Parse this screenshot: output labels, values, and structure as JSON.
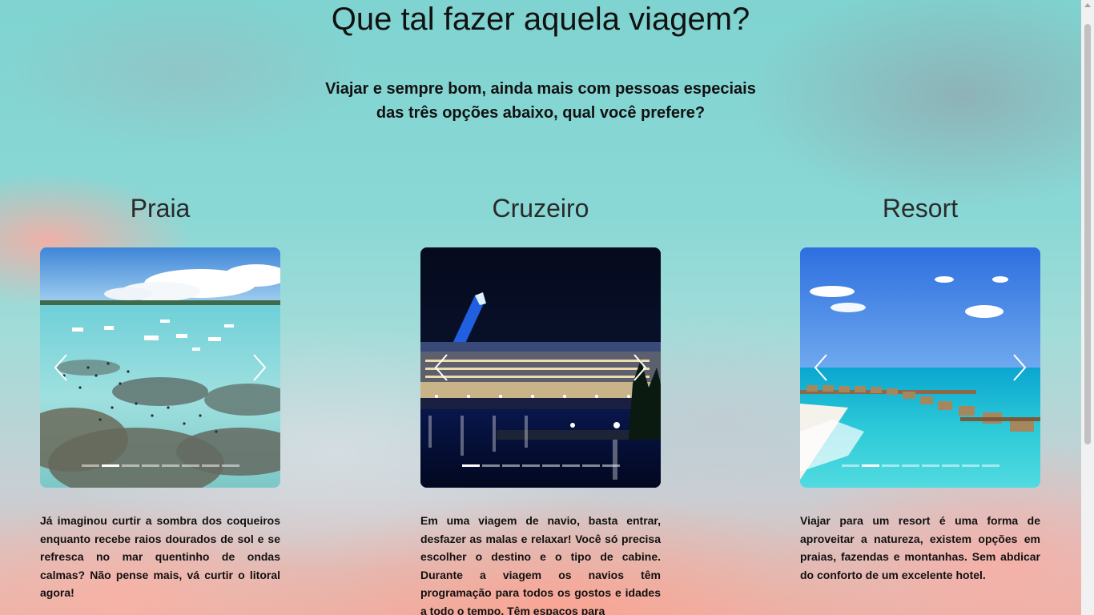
{
  "header": {
    "title": "Que tal fazer aquela viagem?",
    "subtitle_line1": "Viajar e sempre bom, ainda mais com pessoas especiais",
    "subtitle_line2": "das três opções abaixo, qual você prefere?"
  },
  "cards": [
    {
      "title": "Praia",
      "text": "Já imaginou curtir a sombra dos coqueiros enquanto recebe raios dourados de sol e se refresca no mar quentinho de ondas calmas? Não pense mais, vá curtir o litoral agora!",
      "slides": 8,
      "active_slide": 2
    },
    {
      "title": "Cruzeiro",
      "text": "Em uma viagem de navio, basta entrar, desfazer as malas e relaxar! Você só precisa escolher o destino e o tipo de cabine. Durante a viagem os navios têm programação para todos os gostos e idades a todo o tempo. Têm espaços para",
      "slides": 8,
      "active_slide": 1
    },
    {
      "title": "Resort",
      "text": "Viajar para um resort é uma forma de aproveitar a natureza, existem opções em praias, fazendas e montanhas. Sem abdicar do conforto de um excelente hotel.",
      "slides": 8,
      "active_slide": 2
    }
  ],
  "icons": {
    "prev": "chevron-left-icon",
    "next": "chevron-right-icon"
  },
  "colors": {
    "sky": "#8ad8d6",
    "text": "#111111",
    "indicator_active": "#ffffff"
  }
}
